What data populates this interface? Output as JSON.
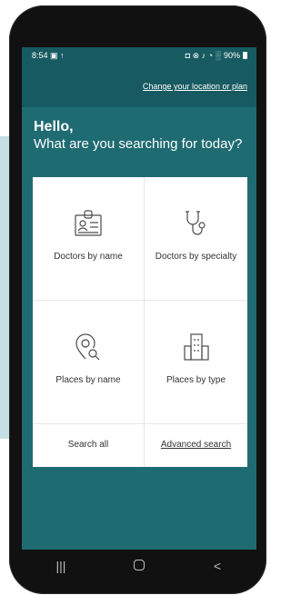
{
  "status_bar": {
    "time": "8:54",
    "left_icons": "▣ ↑",
    "right_icons": "◘ ⊗ ♪ ◔ ░",
    "battery": "90%"
  },
  "header": {
    "change_link": "Change your location or plan",
    "hello": "Hello,",
    "subtitle": "What are you searching for today?"
  },
  "search_options": [
    {
      "label": "Doctors by name",
      "icon": "id-badge-icon"
    },
    {
      "label": "Doctors by specialty",
      "icon": "stethoscope-icon"
    },
    {
      "label": "Places by name",
      "icon": "location-search-icon"
    },
    {
      "label": "Places by type",
      "icon": "building-icon"
    }
  ],
  "footer_actions": {
    "search_all": "Search all",
    "advanced_search": "Advanced search"
  },
  "nav_bar": {
    "recents": "|||",
    "back": "<"
  },
  "colors": {
    "teal_bg": "#1f6b72",
    "teal_dark": "#175a61",
    "accent_panel": "#c3dfe4"
  }
}
